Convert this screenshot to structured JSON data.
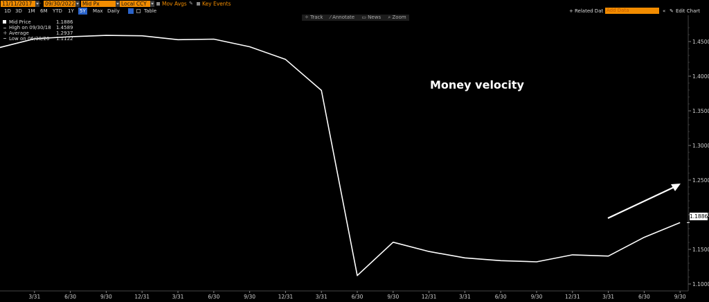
{
  "toolbar": {
    "start_date": "11/11/2017",
    "end_date": "09/30/2022",
    "field": "Mid Px",
    "currency": "Local CCY",
    "mov_avgs": "Mov Avgs",
    "key_events": "Key Events"
  },
  "periods": [
    "1D",
    "3D",
    "1M",
    "6M",
    "YTD",
    "1Y",
    "5Y",
    "Max"
  ],
  "selected_period": "5Y",
  "frequency": "Daily",
  "table_label": "Table",
  "chart_tools": [
    "Track",
    "Annotate",
    "News",
    "Zoom"
  ],
  "right_controls": {
    "related_data": "Related Dat",
    "add_data": "Add Data",
    "edit_chart": "Edit Chart"
  },
  "legend": [
    {
      "label": "Mid Price",
      "value": "1.1886"
    },
    {
      "label": "High on 09/30/18",
      "value": "1.4589"
    },
    {
      "label": "Average",
      "value": "1.2937"
    },
    {
      "label": "Low on 06/30/20",
      "value": "1.1122"
    }
  ],
  "last_value_label": "1.1886",
  "colors": {
    "accent": "#f28c00",
    "series": "#ffffff",
    "background": "#000000",
    "selected": "#2a63c9"
  },
  "chart_data": {
    "type": "line",
    "title": "Money velocity",
    "x": [
      "12/31",
      "3/31",
      "6/30",
      "9/30",
      "12/31",
      "3/31",
      "6/30",
      "9/30",
      "12/31",
      "3/31",
      "6/30",
      "9/30",
      "12/31",
      "3/31",
      "6/30",
      "9/30",
      "12/31",
      "3/31",
      "6/30",
      "9/30"
    ],
    "series": [
      {
        "values": [
          1.441,
          1.454,
          1.457,
          1.4589,
          1.4583,
          1.4527,
          1.4535,
          1.4425,
          1.4242,
          1.3795,
          1.1122,
          1.1603,
          1.1469,
          1.1377,
          1.1337,
          1.132,
          1.1421,
          1.1403,
          1.1674,
          1.1886
        ]
      }
    ],
    "x_tick_labels": [
      "3/31",
      "6/30",
      "9/30",
      "12/31",
      "3/31",
      "6/30",
      "9/30",
      "12/31",
      "3/31",
      "6/30",
      "9/30",
      "12/31",
      "3/31",
      "6/30",
      "9/30",
      "12/31",
      "3/31",
      "6/30",
      "9/30"
    ],
    "y_ticks": [
      1.1,
      1.15,
      1.2,
      1.25,
      1.3,
      1.35,
      1.4,
      1.45
    ],
    "y_tick_labels": [
      "1.1000",
      "1.1500",
      "1.2000",
      "1.2500",
      "1.3000",
      "1.3500",
      "1.4000",
      "1.4500"
    ],
    "ylim": [
      1.09,
      1.488
    ],
    "grid": false,
    "legend": "top-left"
  }
}
